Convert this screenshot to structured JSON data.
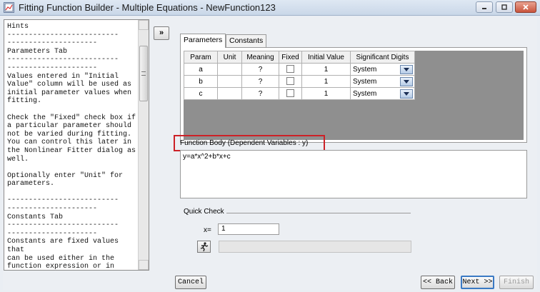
{
  "window": {
    "title": "Fitting Function Builder - Multiple Equations - NewFunction123",
    "controls": [
      "minimize",
      "maximize",
      "close"
    ]
  },
  "hints": {
    "title": "Hints",
    "text": "--------------------------\n---------------------\nParameters Tab\n--------------------------\n---------------------\nValues entered in \"Initial\nValue\" column will be used as\ninitial parameter values when\nfitting.\n\nCheck the \"Fixed\" check box if\na particular parameter should\nnot be varied during fitting.\nYou can control this later in\nthe Nonlinear Fitter dialog as\nwell.\n\nOptionally enter \"Unit\" for\nparameters.\n\n--------------------------\n---------------------\nConstants Tab\n--------------------------\n---------------------\nConstants are fixed values that\ncan be used either in the\nfunction expression or in"
  },
  "expand_button": "»",
  "tabs": [
    {
      "label": "Parameters",
      "active": true
    },
    {
      "label": "Constants",
      "active": false
    }
  ],
  "param_table": {
    "headers": [
      "Param",
      "Unit",
      "Meaning",
      "Fixed",
      "Initial Value",
      "Significant Digits"
    ],
    "rows": [
      {
        "param": "a",
        "unit": "",
        "meaning": "?",
        "fixed": false,
        "initial": "1",
        "digits": "System"
      },
      {
        "param": "b",
        "unit": "",
        "meaning": "?",
        "fixed": false,
        "initial": "1",
        "digits": "System"
      },
      {
        "param": "c",
        "unit": "",
        "meaning": "?",
        "fixed": false,
        "initial": "1",
        "digits": "System"
      }
    ]
  },
  "function_body": {
    "label": "Function Body (Dependent Variables : y)",
    "value": "y=a*x^2+b*x+c"
  },
  "quick_check": {
    "title": "Quick Check",
    "x_label": "x=",
    "x_value": "1",
    "result": ""
  },
  "buttons": {
    "cancel": "Cancel",
    "back": "<< Back",
    "next": "Next >>",
    "finish": "Finish"
  },
  "colors": {
    "highlight_box": "#cc2127",
    "grid_background": "#8f8f8f",
    "primary_button_border": "#3a79c3"
  }
}
